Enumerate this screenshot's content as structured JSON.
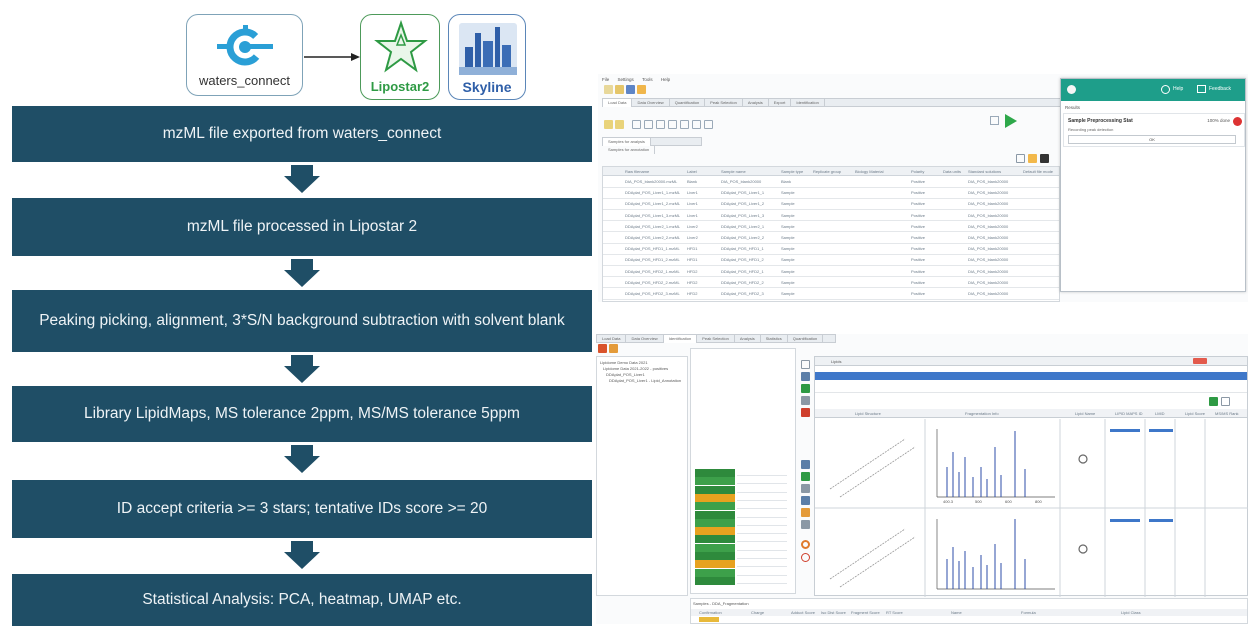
{
  "logos": {
    "waters_label": "waters_connect",
    "lipostar_label": "Lipostar2",
    "skyline_label": "Skyline"
  },
  "steps": [
    "mzML file exported from waters_connect",
    "mzML file processed in Lipostar 2",
    "Peaking picking, alignment, 3*S/N background subtraction with solvent blank",
    "Library LipidMaps, MS tolerance 2ppm, MS/MS tolerance 5ppm",
    "ID accept criteria >= 3 stars; tentative IDs score >= 20",
    "Statistical Analysis: PCA, heatmap, UMAP etc."
  ],
  "colors": {
    "step_box": "#1f4e66",
    "arrow": "#1f4e66",
    "step_text": "#eef3f6",
    "app_header": "#1e9e8a",
    "lipostar_green": "#2e9a44",
    "skyline_blue": "#2f5fa8"
  },
  "screenshot_top": {
    "menu": [
      "File",
      "Settings",
      "Tools",
      "Help"
    ],
    "tabs": [
      "Load Data",
      "Data Overview",
      "Quantification",
      "Peak Selection",
      "Analysis",
      "Export",
      "Identification"
    ],
    "subtabs": [
      "Samples for analysis",
      "Samples for annotation"
    ],
    "columns": [
      "Raw filename",
      "Label",
      "Sample name",
      "Sample type",
      "Replicate group",
      "Biology Material",
      "Polarity",
      "Data units",
      "Standard solutions",
      "Default file mode"
    ],
    "rows": [
      [
        "DIA_POS_blank20000.mzML",
        "Blank",
        "DIA_POS_blank20000",
        "Blank",
        "",
        "",
        "Positive",
        "",
        "DIA_POS_blank20000"
      ],
      [
        "DDAplat_POS_Liver1_1.mzML",
        "Liver1",
        "DDAplat_POS_Liver1_1",
        "Sample",
        "",
        "",
        "Positive",
        "",
        "DIA_POS_blank20000"
      ],
      [
        "DDAplat_POS_Liver1_2.mzML",
        "Liver1",
        "DDAplat_POS_Liver1_2",
        "Sample",
        "",
        "",
        "Positive",
        "",
        "DIA_POS_blank20000"
      ],
      [
        "DDAplat_POS_Liver1_3.mzML",
        "Liver1",
        "DDAplat_POS_Liver1_3",
        "Sample",
        "",
        "",
        "Positive",
        "",
        "DIA_POS_blank20000"
      ],
      [
        "DDAplat_POS_Liver2_1.mzML",
        "Liver2",
        "DDAplat_POS_Liver2_1",
        "Sample",
        "",
        "",
        "Positive",
        "",
        "DIA_POS_blank20000"
      ],
      [
        "DDAplat_POS_Liver2_2.mzML",
        "Liver2",
        "DDAplat_POS_Liver2_2",
        "Sample",
        "",
        "",
        "Positive",
        "",
        "DIA_POS_blank20000"
      ],
      [
        "DDAplat_POS_HFD1_1.mzML",
        "HFD1",
        "DDAplat_POS_HFD1_1",
        "Sample",
        "",
        "",
        "Positive",
        "",
        "DIA_POS_blank20000"
      ],
      [
        "DDAplat_POS_HFD1_2.mzML",
        "HFD1",
        "DDAplat_POS_HFD1_2",
        "Sample",
        "",
        "",
        "Positive",
        "",
        "DIA_POS_blank20000"
      ],
      [
        "DDAplat_POS_HFD2_1.mzML",
        "HFD2",
        "DDAplat_POS_HFD2_1",
        "Sample",
        "",
        "",
        "Positive",
        "",
        "DIA_POS_blank20000"
      ],
      [
        "DDAplat_POS_HFD2_2.mzML",
        "HFD2",
        "DDAplat_POS_HFD2_2",
        "Sample",
        "",
        "",
        "Positive",
        "",
        "DIA_POS_blank20000"
      ],
      [
        "DDAplat_POS_HFD2_3.mzML",
        "HFD2",
        "DDAplat_POS_HFD2_3",
        "Sample",
        "",
        "",
        "Positive",
        "",
        "DIA_POS_blank20000"
      ]
    ],
    "popup": {
      "help": "Help",
      "feedback": "Feedback",
      "section": "Results",
      "job_title": "Sample Preprocessing Stat",
      "job_status": "100% done",
      "job_detail": "Recording peak detection",
      "ok": "OK"
    }
  },
  "screenshot_bottom": {
    "tabs": [
      "Load Data",
      "Data Overview",
      "Identification",
      "Peak Selection",
      "Analysis",
      "Statistics",
      "Quantification"
    ],
    "tree": [
      "Lipidome Demo Data 2021",
      "Lipidome Data 2021-2022 - positives",
      "DDAplat_POS_Liver1",
      "DDAplat_POS_Liver1 - Lipid_Annotation"
    ],
    "search_label": "Lipids",
    "left_columns": [
      "Lipid Structure",
      "Fragmentation Info",
      "Lipid Name",
      "LIPID MAPS ID",
      "LMID",
      "Lipid Score",
      "MS/MS Rank",
      "Formula"
    ],
    "mz_labels_1": [
      "400.3",
      "500",
      "600",
      "800"
    ],
    "footer_label": "Samples  -  DDA_Fragmentation",
    "footer_cols": [
      "Confirmation",
      "Charge",
      "Adduct Score",
      "Iso Dist Score",
      "Fragment Score",
      "RT Score",
      "Name",
      "Formula",
      "Lipid Class"
    ]
  }
}
